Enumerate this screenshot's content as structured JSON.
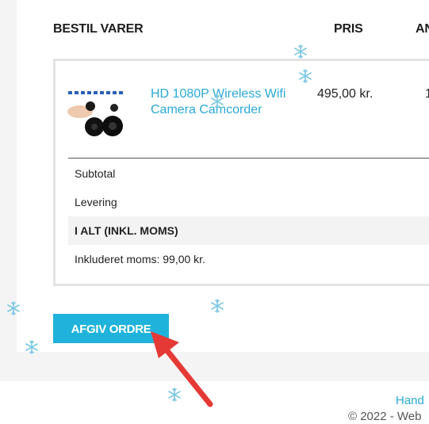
{
  "headers": {
    "product": "BESTIL VARER",
    "price": "PRIS",
    "qty_partial": "AN"
  },
  "item": {
    "name": "HD 1080P Wireless Wifi Camera Camcorder",
    "price": "495,00 kr.",
    "qty_partial": "1"
  },
  "summary": {
    "subtotal_label": "Subtotal",
    "shipping_label": "Levering",
    "total_label": "I ALT (INKL. MOMS)",
    "vat_text": "Inkluderet moms: 99,00 kr."
  },
  "actions": {
    "place_order_label": "AFGIV ORDRE"
  },
  "footer": {
    "link_partial": "Hand",
    "copyright_partial": "© 2022 - Web"
  },
  "colors": {
    "accent": "#1fb3db",
    "link": "#2aa9d6",
    "arrow": "#e53935",
    "snowflake": "#7ec8e3"
  },
  "icons": {
    "snowflake": "snowflake-icon",
    "arrow": "annotation-arrow"
  }
}
